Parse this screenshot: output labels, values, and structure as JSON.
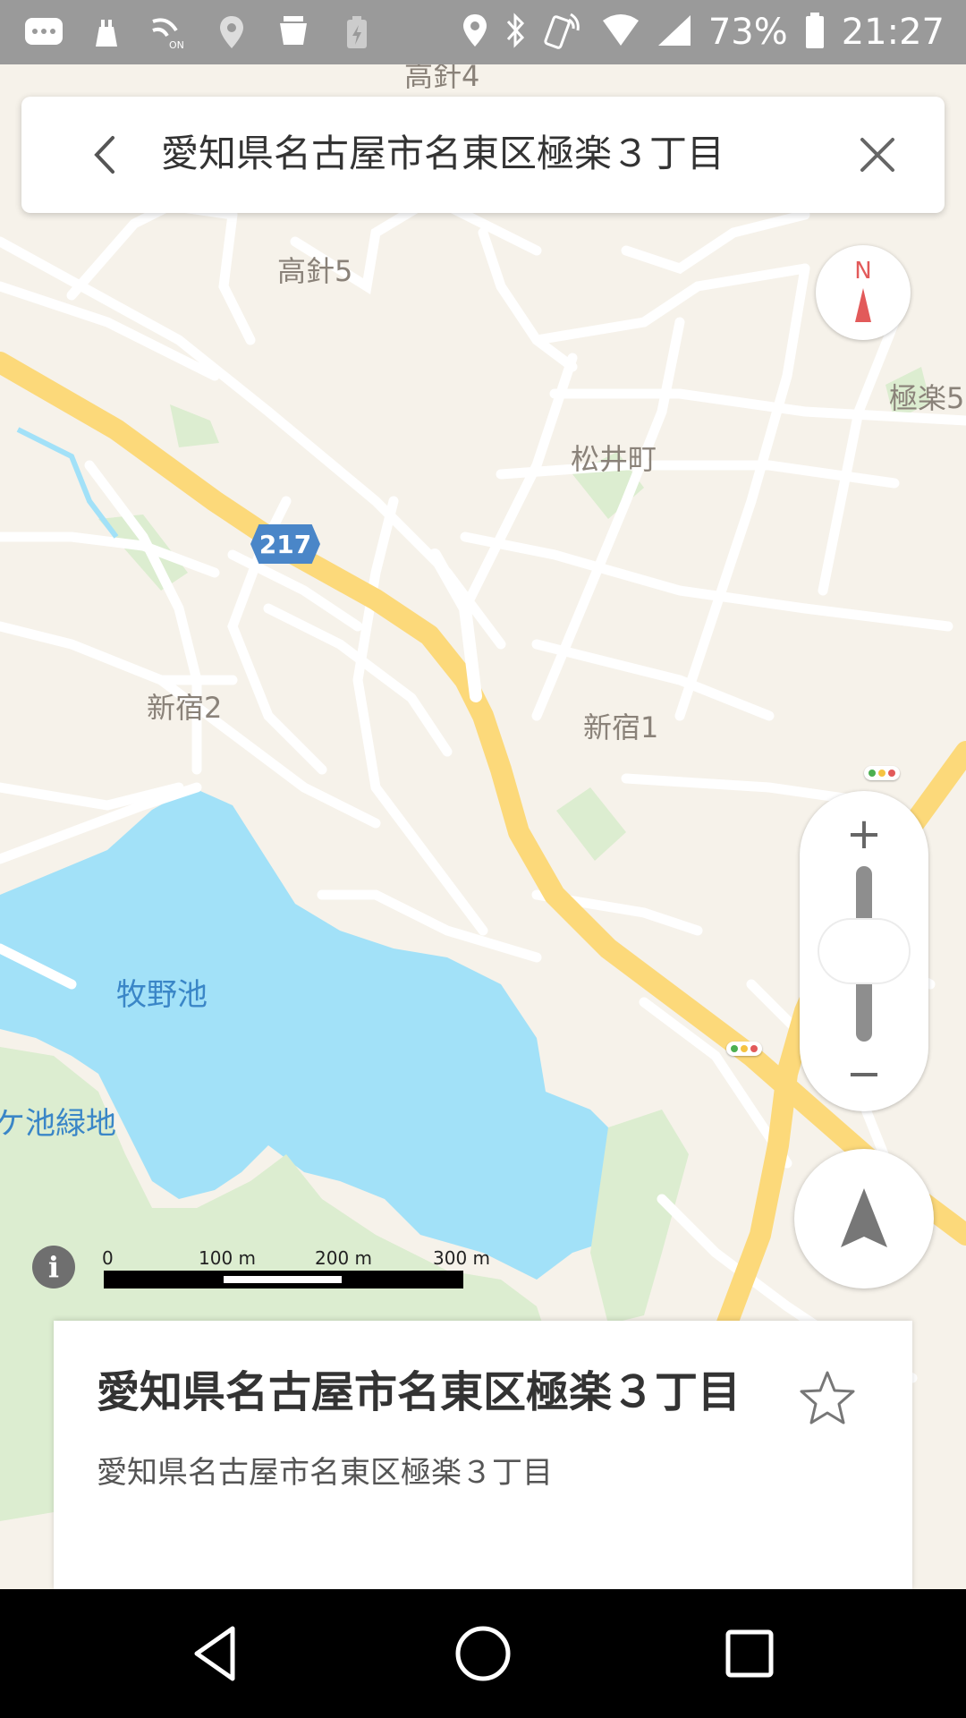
{
  "status_bar": {
    "battery": "73%",
    "time": "21:27",
    "icons": [
      "messages-icon",
      "charger-icon",
      "on-icon",
      "location-icon",
      "cup-icon",
      "battery-saver-icon",
      "location-icon",
      "bluetooth-icon",
      "phone-vibrate-icon",
      "wifi-icon",
      "signal-icon",
      "battery-icon"
    ]
  },
  "search": {
    "query": "愛知県名古屋市名東区極楽３丁目",
    "back_icon": "chevron-left-icon",
    "clear_icon": "close-icon"
  },
  "map": {
    "labels": {
      "takabari4": "高針4",
      "takabari5": "高針5",
      "gokuraku5": "極楽5",
      "matsuicho": "松井町",
      "shinjuku2": "新宿2",
      "shinjuku1": "新宿1",
      "makinoike": "牧野池",
      "park": "ケ池緑地"
    },
    "route_number": "217",
    "colors": {
      "land": "#f6f2ea",
      "road": "#ffffff",
      "major_road": "#fcd97a",
      "water": "#a2e1f8",
      "park": "#dcedd0"
    }
  },
  "compass": {
    "label": "N"
  },
  "zoom": {
    "plus": "+",
    "minus": "−"
  },
  "scale": {
    "labels": [
      "0",
      "100 m",
      "200 m",
      "300 m"
    ]
  },
  "info": {
    "label": "i"
  },
  "place": {
    "title": "愛知県名古屋市名東区極楽３丁目",
    "subtitle": "愛知県名古屋市名東区極楽３丁目",
    "star_icon": "star-outline-icon"
  },
  "nav": {
    "back": "back-triangle-icon",
    "home": "home-circle-icon",
    "recents": "recents-square-icon"
  }
}
